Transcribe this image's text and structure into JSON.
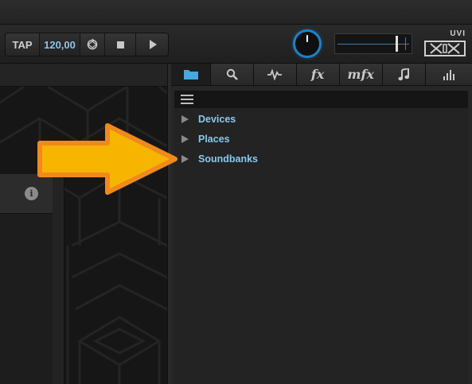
{
  "transport": {
    "tap_label": "TAP",
    "tempo_value": "120,00",
    "sync_icon": "sync-icon",
    "stop_icon": "stop-icon",
    "play_icon": "play-icon"
  },
  "header": {
    "logo_text": "UVI",
    "volume_knob_icon": "knob-icon"
  },
  "browser": {
    "tabs": [
      {
        "name": "folder-icon",
        "label": ""
      },
      {
        "name": "search-icon",
        "label": ""
      },
      {
        "name": "waveform-icon",
        "label": ""
      },
      {
        "name": "fx",
        "label": "fx"
      },
      {
        "name": "mfx",
        "label": "mfx"
      },
      {
        "name": "music-note-icon",
        "label": ""
      },
      {
        "name": "bars-icon",
        "label": ""
      }
    ],
    "tree": [
      {
        "label": "Devices"
      },
      {
        "label": "Places"
      },
      {
        "label": "Soundbanks"
      }
    ]
  },
  "left_panel": {
    "info_icon": "info-icon",
    "info_glyph": "i"
  },
  "colors": {
    "accent": "#8ac8ec",
    "knob_ring": "#1e82c4",
    "arrow_fill": "#f7b500",
    "arrow_outline": "#f08a1c"
  }
}
